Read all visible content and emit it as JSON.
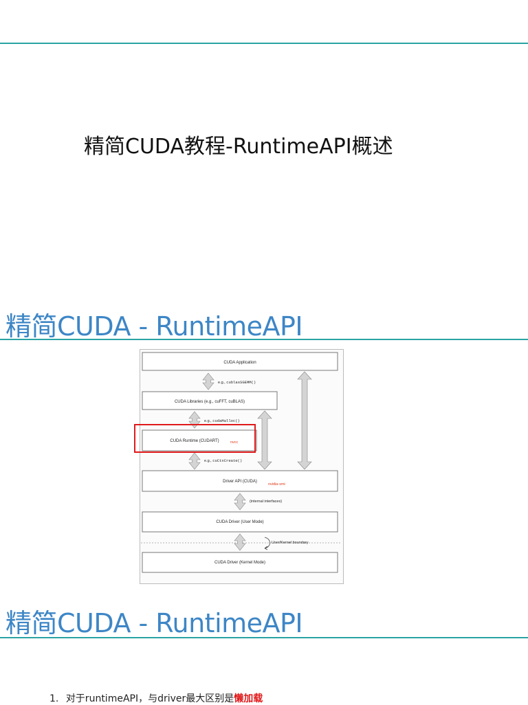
{
  "cover": {
    "title": "精简CUDA教程-RuntimeAPI概述"
  },
  "slide2": {
    "heading": "精简CUDA - RuntimeAPI",
    "diagram": {
      "boxes": {
        "app": "CUDA Application",
        "libs": "CUDA Libraries (e.g., cuFFT, cuBLAS)",
        "runtime": "CUDA Runtime (CUDART)",
        "driver_api": "Driver API (CUDA)",
        "driver_user": "CUDA Driver (User Mode)",
        "driver_kernel": "CUDA Driver (Kernel Mode)"
      },
      "arrow_labels": {
        "eg1_prefix": "e.g., ",
        "eg1_code": "cublasSGEMM()",
        "eg2_prefix": "e.g., ",
        "eg2_code": "cudaMalloc()",
        "eg3_prefix": "e.g., ",
        "eg3_code": "cuCtxCreate()",
        "internal": "(internal interfaces)",
        "boundary": "User/Kernel boundary"
      },
      "annotations": {
        "nvcc": "nvcc",
        "nvidia_smi": "nvidia-smi"
      },
      "colors": {
        "highlight": "#e0191a",
        "annotation": "#e0391a",
        "arrow_fill": "#d4d4d4",
        "arrow_stroke": "#888888"
      }
    }
  },
  "slide3": {
    "heading": "精简CUDA - RuntimeAPI",
    "bullet_number": "1.",
    "bullet_text": "对于runtimeAPI，与driver最大区别是",
    "bullet_emphasis": "懒加载"
  },
  "colors": {
    "rule": "#2aa3a3",
    "heading": "#3d86c6"
  }
}
